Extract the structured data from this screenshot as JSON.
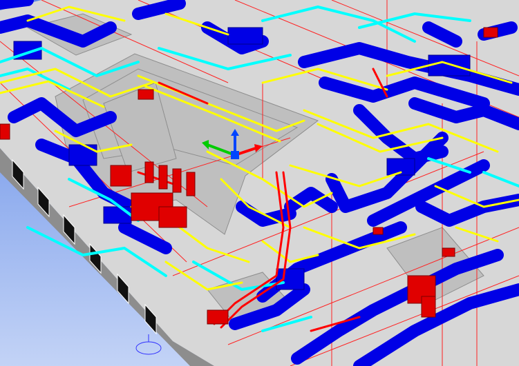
{
  "viewport": {
    "background_gradient": [
      "#5b86e6",
      "#c3d3f6"
    ],
    "view": "3d-perspective"
  },
  "palette": {
    "slab": "#d7d7d7",
    "slab_shadow": "#bdbdbd",
    "wall": "#bfbfbf",
    "wall_dark": "#8d8d8d",
    "hvac_duct": "#0000e6",
    "hvac_duct_edge": "#00008a",
    "pipe_yellow": "#ffff00",
    "pipe_cyan": "#00ffff",
    "pipe_red": "#ff0000",
    "equipment_red": "#e00000",
    "outline_red": "#ff2020",
    "window": "#111111",
    "gizmo_x": "#ff0000",
    "gizmo_y": "#00cc00",
    "gizmo_z": "#0044ff"
  },
  "gizmo": {
    "icon": "transform-gizmo-icon",
    "axes": [
      "x",
      "y",
      "z"
    ]
  },
  "view_cursor": {
    "icon": "orbit-cursor-icon"
  }
}
